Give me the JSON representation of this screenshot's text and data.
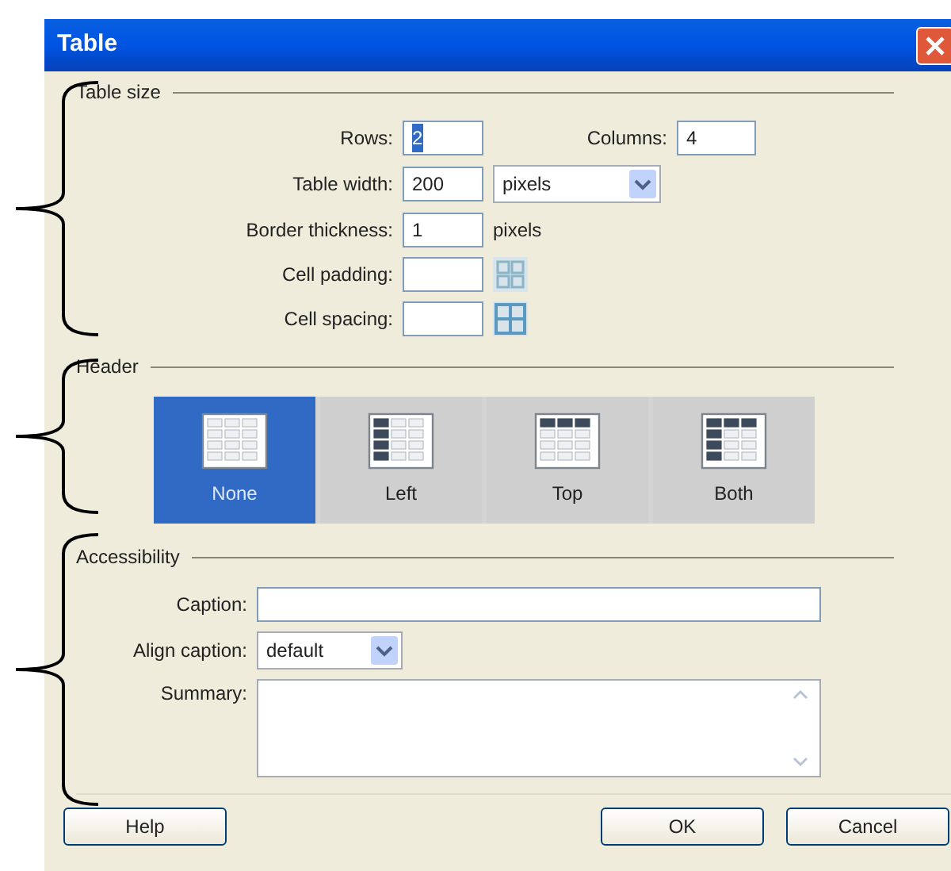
{
  "window": {
    "title": "Table"
  },
  "table_size": {
    "legend": "Table size",
    "rows": {
      "label": "Rows:",
      "value": "2",
      "text_selected": true
    },
    "columns": {
      "label": "Columns:",
      "value": "4"
    },
    "table_width": {
      "label": "Table width:",
      "value": "200",
      "unit": "pixels"
    },
    "border_thickness": {
      "label": "Border thickness:",
      "value": "1",
      "unit": "pixels"
    },
    "cell_padding": {
      "label": "Cell padding:"
    },
    "cell_spacing": {
      "label": "Cell spacing:"
    }
  },
  "header": {
    "legend": "Header",
    "options": [
      {
        "label": "None",
        "kind": "none",
        "selected": true
      },
      {
        "label": "Left",
        "kind": "left",
        "selected": false
      },
      {
        "label": "Top",
        "kind": "top",
        "selected": false
      },
      {
        "label": "Both",
        "kind": "both",
        "selected": false
      }
    ]
  },
  "accessibility": {
    "legend": "Accessibility",
    "caption": {
      "label": "Caption:"
    },
    "align_caption": {
      "label": "Align caption:",
      "value": "default"
    },
    "summary": {
      "label": "Summary:"
    }
  },
  "buttons": [
    {
      "label": "Help"
    },
    {
      "label": "OK"
    },
    {
      "label": "Cancel"
    }
  ]
}
